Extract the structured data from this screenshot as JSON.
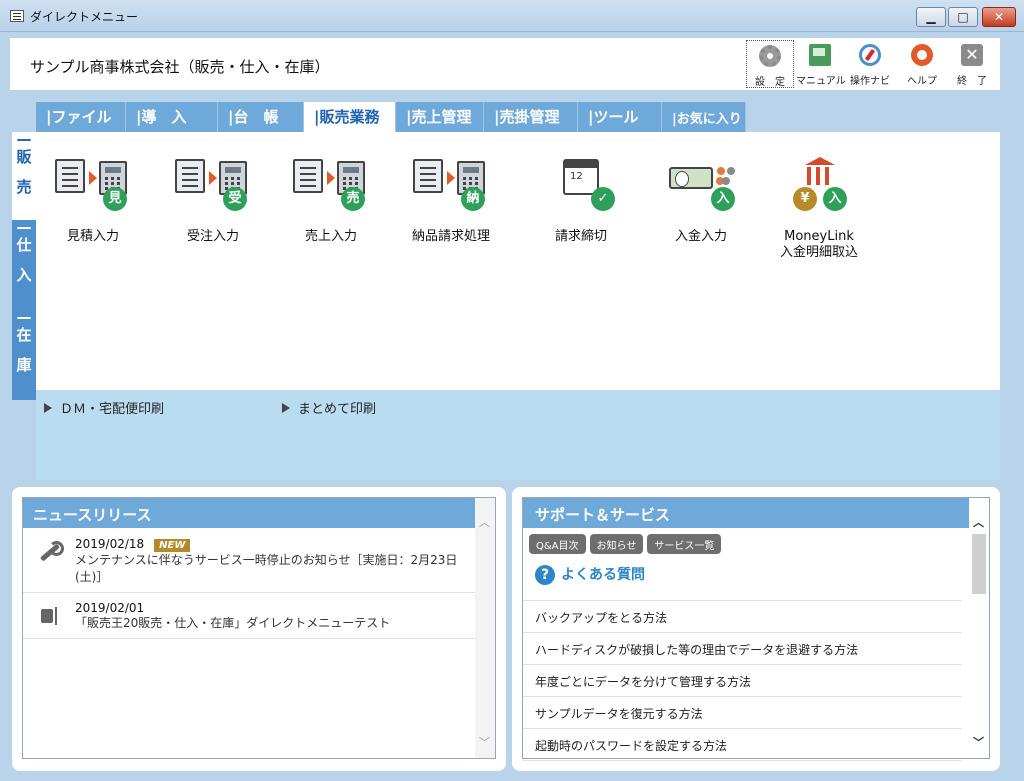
{
  "window": {
    "title": "ダイレクトメニュー"
  },
  "header": {
    "company": "サンプル商事株式会社（販売・仕入・在庫）",
    "tools": {
      "settings": "設　定",
      "manual": "マニュアル",
      "navi": "操作ナビ",
      "help": "ヘルプ",
      "exit": "終　了"
    }
  },
  "tabs": [
    "ファイル",
    "導　入",
    "台　帳",
    "販売業務",
    "売上管理",
    "売掛管理",
    "ツール",
    "お気に入り"
  ],
  "side_tabs": [
    {
      "chars": [
        "販",
        "売"
      ]
    },
    {
      "chars": [
        "仕",
        "入"
      ]
    },
    {
      "chars": [
        "在",
        "庫"
      ]
    }
  ],
  "functions": [
    {
      "badge": "見",
      "label": "見積入力"
    },
    {
      "badge": "受",
      "label": "受注入力"
    },
    {
      "badge": "売",
      "label": "売上入力"
    },
    {
      "badge": "納",
      "label": "納品請求処理"
    },
    {
      "calendar": "12",
      "label": "請求締切"
    },
    {
      "badge": "入",
      "label": "入金入力"
    },
    {
      "badge_left": "¥",
      "badge": "入",
      "label_line1": "MoneyLink",
      "label_line2": "入金明細取込"
    }
  ],
  "shortcuts": [
    "ＤＭ・宅配便印刷",
    "まとめて印刷"
  ],
  "news": {
    "title": "ニュースリリース",
    "items": [
      {
        "date": "2019/02/18",
        "tag": "NEW",
        "text": "メンテナンスに伴なうサービス一時停止のお知らせ［実施日：2月23日(土)］"
      },
      {
        "date": "2019/02/01",
        "text": "「販売王20販売・仕入・在庫」ダイレクトメニューテスト"
      }
    ]
  },
  "support": {
    "title": "サポート＆サービス",
    "buttons": [
      "Q&A目次",
      "お知らせ",
      "サービス一覧"
    ],
    "faq_title": "よくある質問",
    "faq": [
      "バックアップをとる方法",
      "ハードディスクが破損した等の理由でデータを退避する方法",
      "年度ごとにデータを分けて管理する方法",
      "サンプルデータを復元する方法",
      "起動時のパスワードを設定する方法"
    ]
  }
}
